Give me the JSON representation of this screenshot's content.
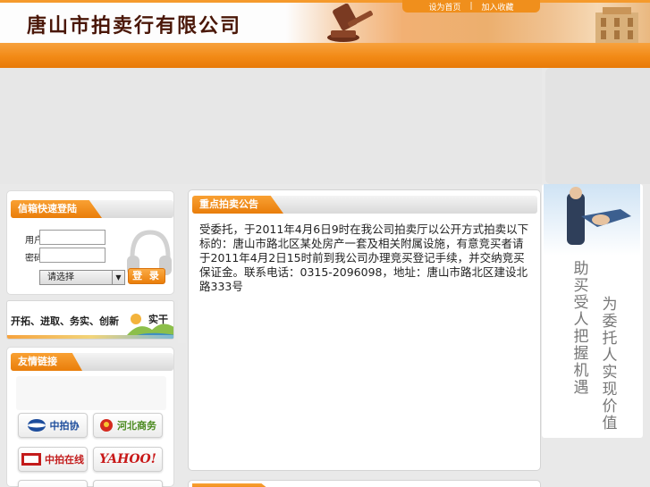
{
  "header": {
    "site_title": "唐山市拍卖行有限公司",
    "links": [
      "设为首页",
      "|",
      "加入收藏"
    ]
  },
  "login": {
    "title": "信箱快速登陆",
    "user_label": "用户",
    "password_label": "密码",
    "select_value": "请选择",
    "login_button": "登 录"
  },
  "slogan": {
    "text": "开拓、进取、务实、创新",
    "tail": "实干"
  },
  "links_panel": {
    "title": "友情链接",
    "items": [
      "中拍协",
      "河北商务",
      "中拍在线",
      "YAHOO!"
    ]
  },
  "notice": {
    "title": "重点拍卖公告",
    "body": "受委托，于2011年4月6日9时在我公司拍卖厅以公开方式拍卖以下标的：唐山市路北区某处房产一套及相关附属设施，有意竞买者请于2011年4月2日15时前到我公司办理竞买登记手续，并交纳竞买保证金。联系电话：0315-2096098，地址：唐山市路北区建设北路333号"
  },
  "right_panel": {
    "text1": "助买受人把握机遇",
    "text2": "为委托人实现价值"
  },
  "colors": {
    "accent_orange": "#f28a16",
    "title_brown": "#4a1708"
  }
}
